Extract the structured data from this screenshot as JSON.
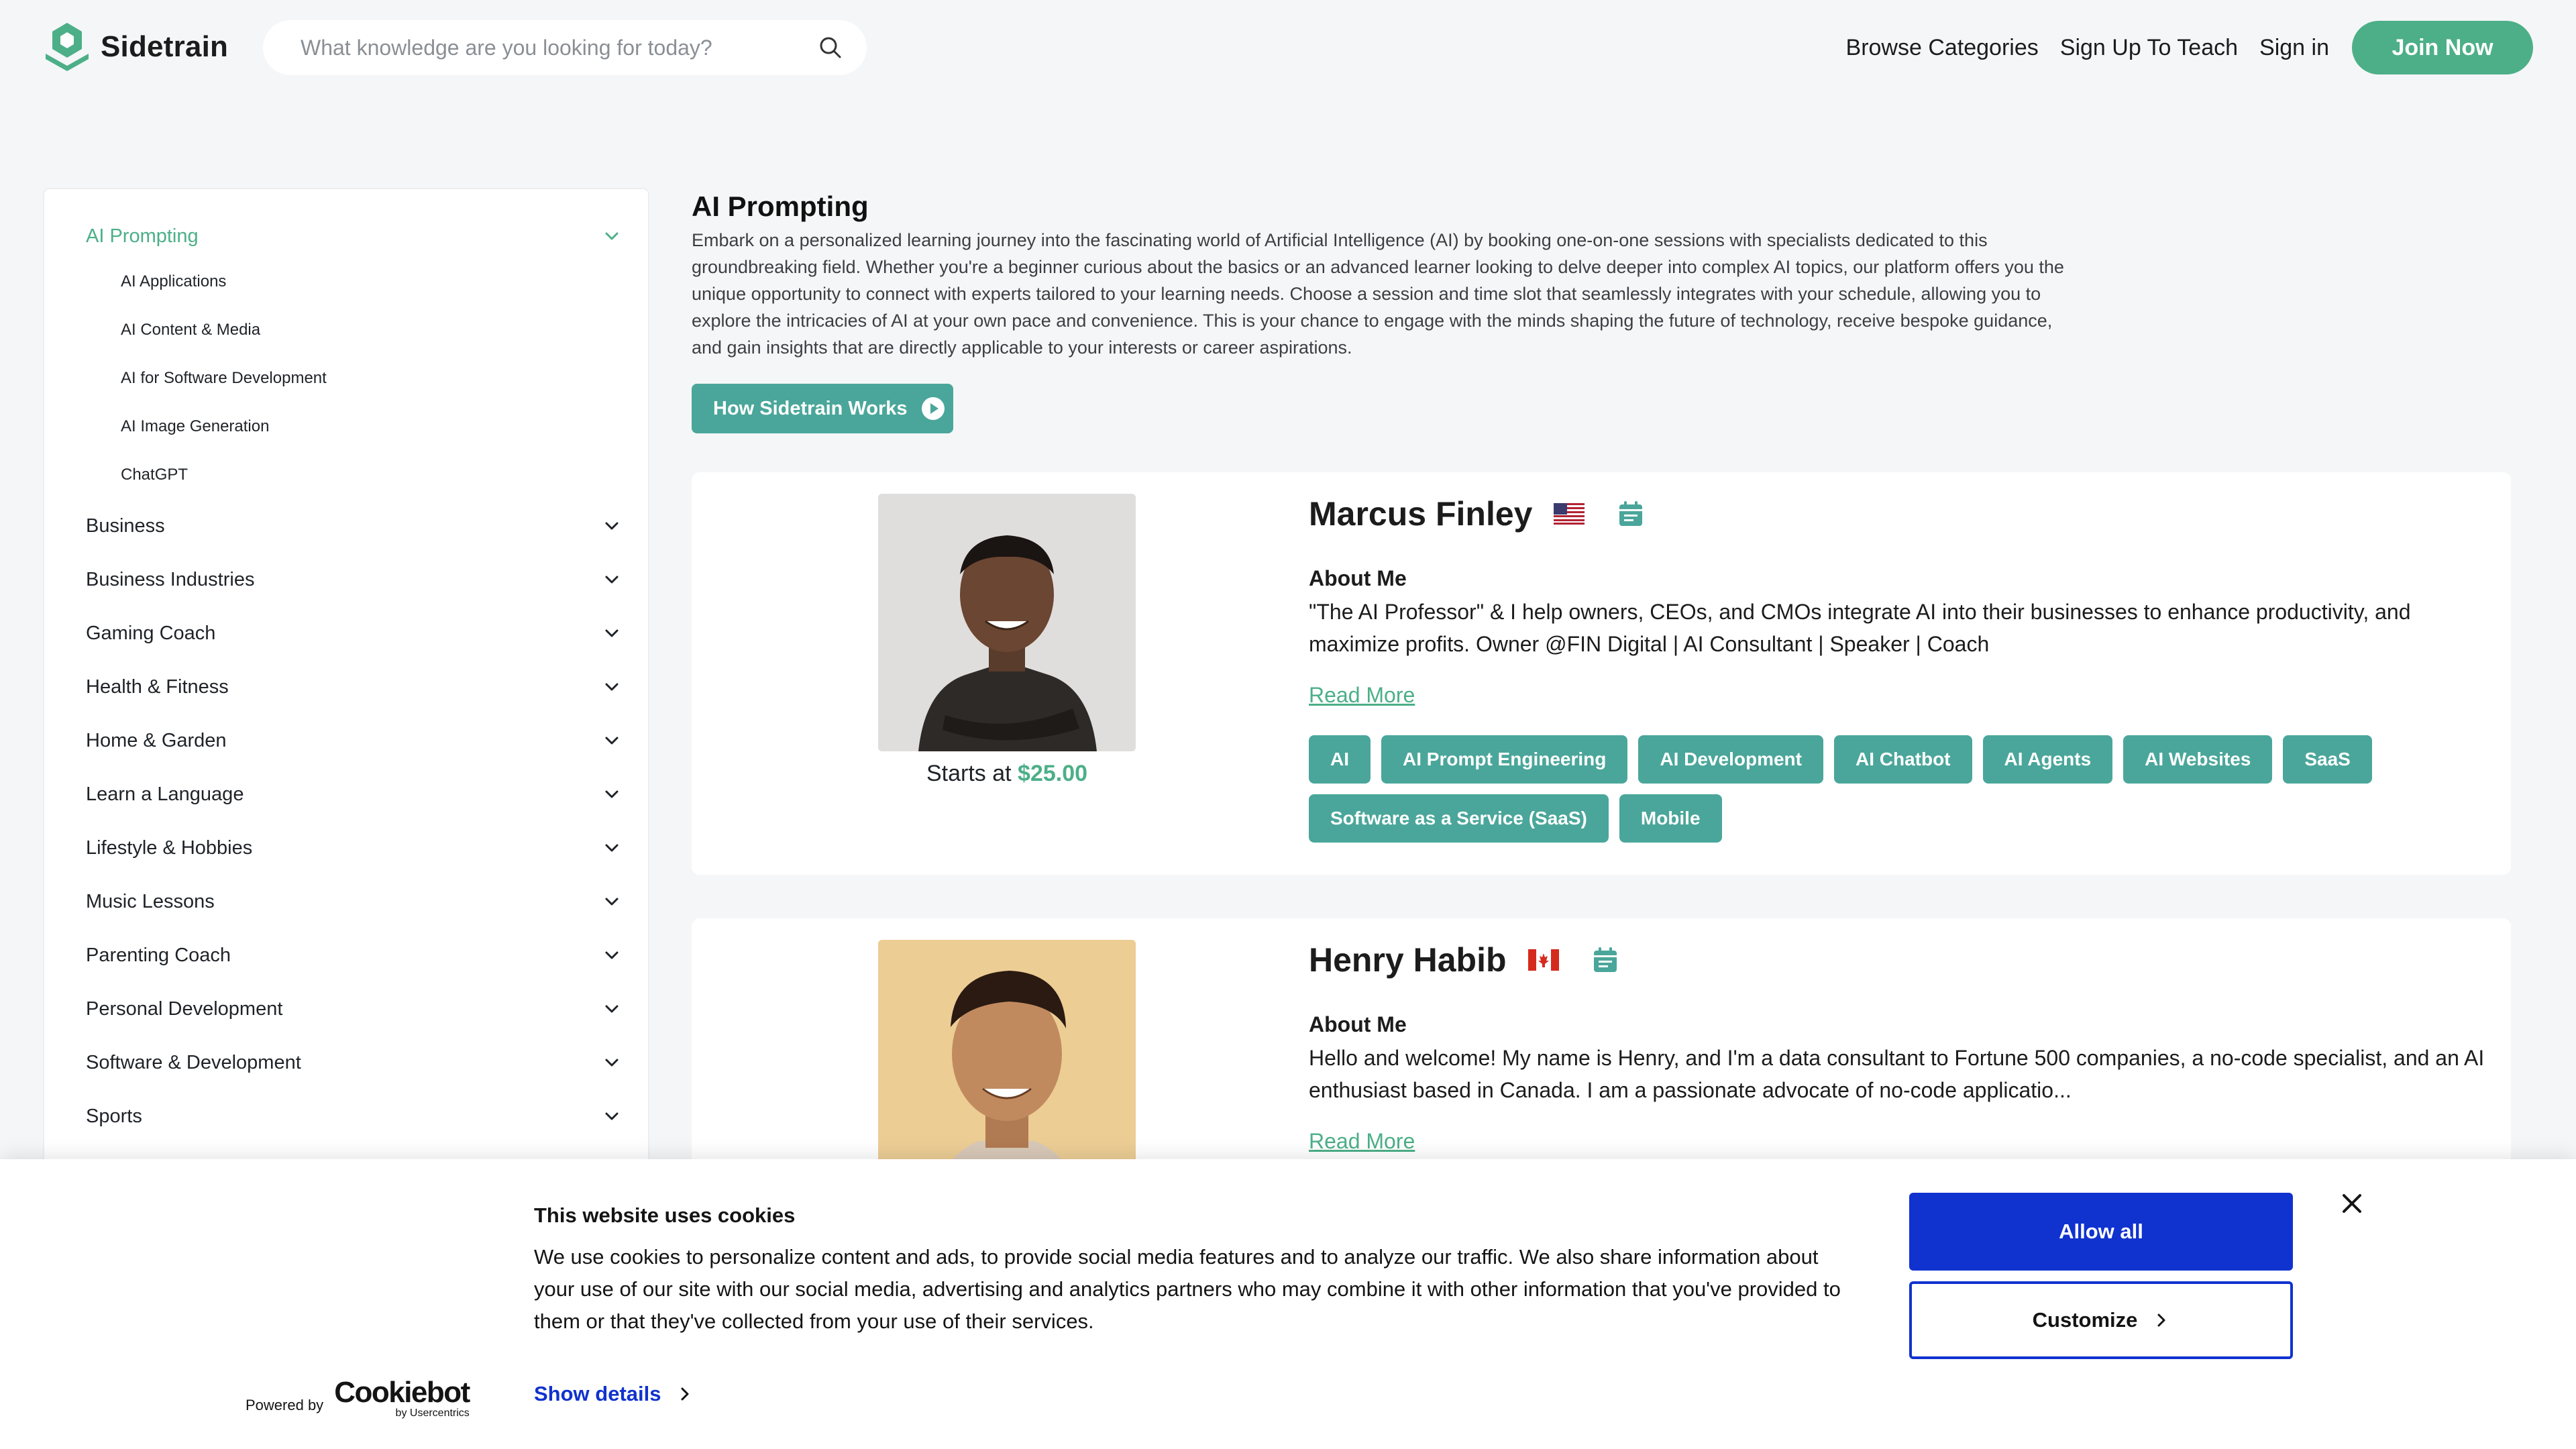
{
  "header": {
    "brand": "Sidetrain",
    "search_placeholder": "What knowledge are you looking for today?",
    "nav": {
      "browse": "Browse Categories",
      "teach": "Sign Up To Teach",
      "signin": "Sign in",
      "join": "Join Now"
    }
  },
  "sidebar": {
    "active": "AI Prompting",
    "subcategories": [
      "AI Applications",
      "AI Content & Media",
      "AI for Software Development",
      "AI Image Generation",
      "ChatGPT"
    ],
    "categories": [
      "Business",
      "Business Industries",
      "Gaming Coach",
      "Health & Fitness",
      "Home & Garden",
      "Learn a Language",
      "Lifestyle & Hobbies",
      "Music Lessons",
      "Parenting Coach",
      "Personal Development",
      "Software & Development",
      "Sports"
    ]
  },
  "main": {
    "title": "AI Prompting",
    "description": "Embark on a personalized learning journey into the fascinating world of Artificial Intelligence (AI) by booking one-on-one sessions with specialists dedicated to this groundbreaking field. Whether you're a beginner curious about the basics or an advanced learner looking to delve deeper into complex AI topics, our platform offers you the unique opportunity to connect with experts tailored to your learning needs. Choose a session and time slot that seamlessly integrates with your schedule, allowing you to explore the intricacies of AI at your own pace and convenience. This is your chance to engage with the minds shaping the future of technology, receive bespoke guidance, and gain insights that are directly applicable to your interests or career aspirations.",
    "how_button": "How Sidetrain Works"
  },
  "tutors": [
    {
      "name": "Marcus Finley",
      "about_title": "About Me",
      "about": "\"The AI Professor\" & I help owners, CEOs, and CMOs integrate AI into their businesses to enhance productivity, and maximize profits. Owner @FIN Digital | AI Consultant | Speaker | Coach",
      "read_more": "Read More",
      "price_prefix": "Starts at",
      "price": "$25.00",
      "tags": [
        "AI",
        "AI Prompt Engineering",
        "AI Development",
        "AI Chatbot",
        "AI Agents",
        "AI Websites",
        "SaaS",
        "Software as a Service (SaaS)",
        "Mobile"
      ]
    },
    {
      "name": "Henry Habib",
      "about_title": "About Me",
      "about": "Hello and welcome! My name is Henry, and I'm a data consultant to Fortune 500 companies, a no-code specialist, and an AI enthusiast based in Canada. I am a passionate advocate of no-code applicatio...",
      "read_more": "Read More"
    }
  ],
  "cookie": {
    "title": "This website uses cookies",
    "text": "We use cookies to personalize content and ads, to provide social media features and to analyze our traffic. We also share information about your use of our site with our social media, advertising and analytics partners who may combine it with other information that you've provided to them or that they've collected from your use of their services.",
    "show_details": "Show details",
    "powered_by": "Powered by",
    "brand": "Cookiebot",
    "brand_sub": "by Usercentrics",
    "allow_all": "Allow all",
    "customize": "Customize"
  },
  "colors": {
    "brand_green": "#4caf88",
    "teal_button": "#4aa69a",
    "cookie_blue": "#1032cf"
  }
}
